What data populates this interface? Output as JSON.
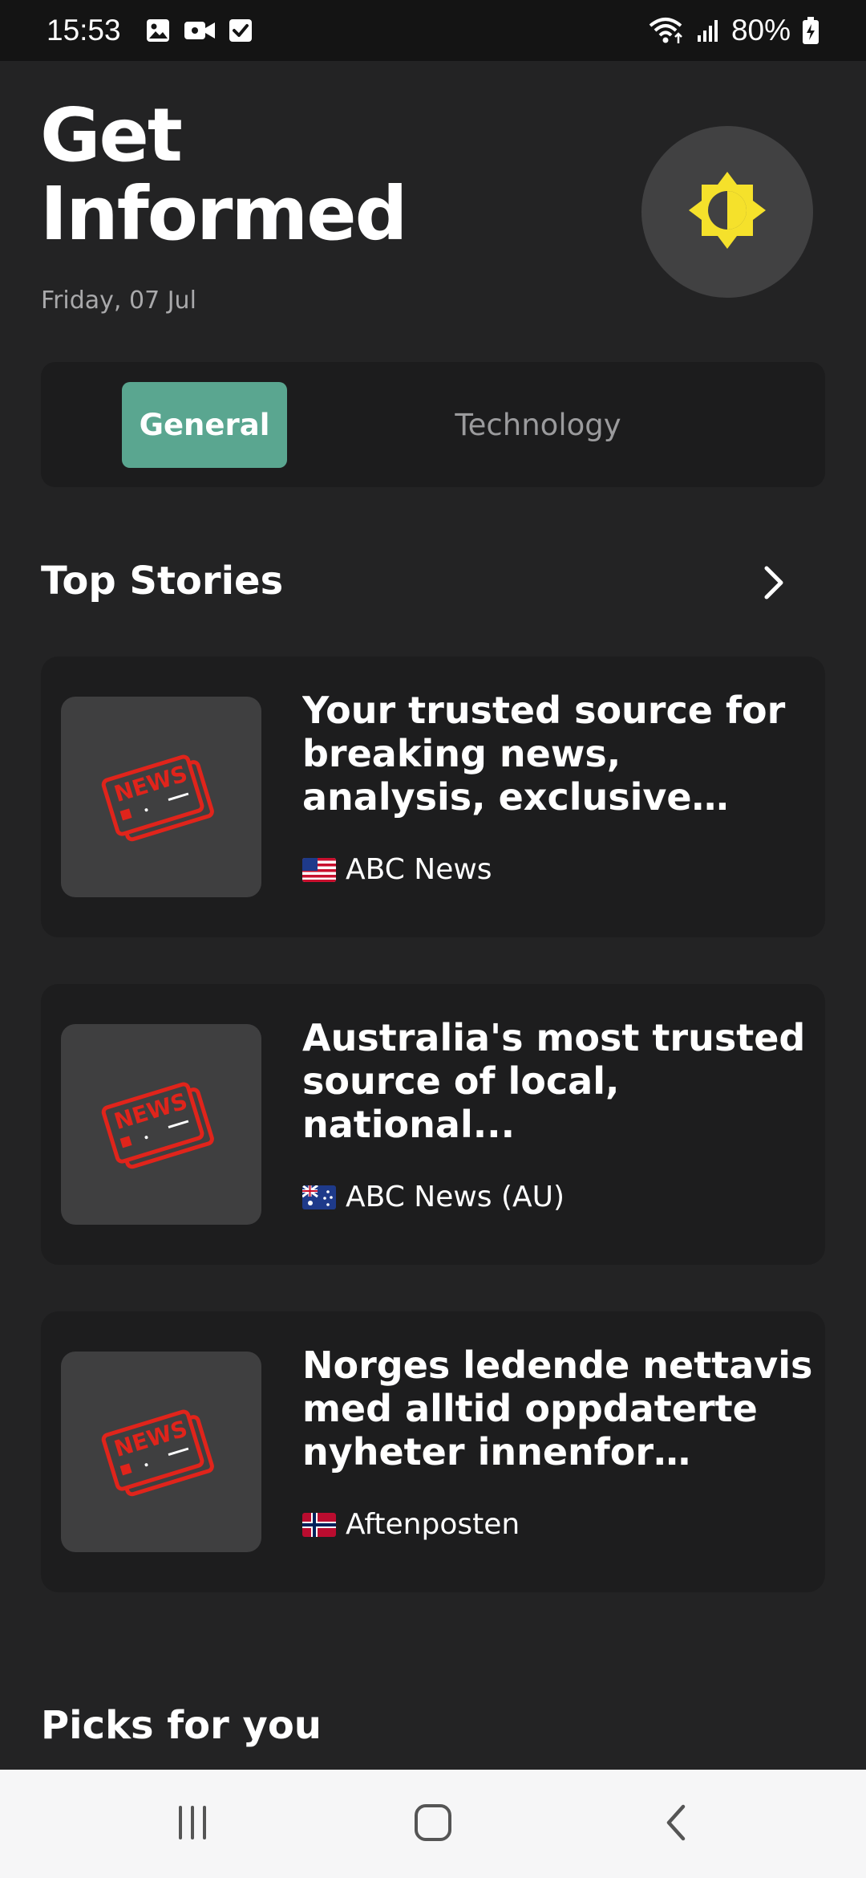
{
  "status_bar": {
    "time": "15:53",
    "battery": "80%",
    "icons": [
      "image-icon",
      "video-icon",
      "checkbox-icon",
      "wifi-icon",
      "signal-icon",
      "battery-icon"
    ]
  },
  "header": {
    "title": "Get Informed",
    "date": "Friday, 07 Jul",
    "theme_icon": "brightness-icon",
    "accent_color": "#f5e12b"
  },
  "tabs": [
    {
      "label": "General",
      "selected": true
    },
    {
      "label": "Technology",
      "selected": false
    }
  ],
  "accent_color": "#5aa690",
  "top_stories": {
    "title": "Top Stories",
    "arrow_icon": "chevron-right-icon",
    "items": [
      {
        "headline": "Your trusted source for breaking news, analysis, exclusive interviews, h...",
        "source": "ABC News",
        "flag": "us-flag-icon",
        "thumbnail": "news-placeholder-icon"
      },
      {
        "headline": "Australia's most trusted source of local, national...",
        "source": "ABC News (AU)",
        "flag": "au-flag-icon",
        "thumbnail": "news-placeholder-icon"
      },
      {
        "headline": "Norges ledende nettavis med alltid oppdaterte nyheter innenfor innenr...",
        "source": "Aftenposten",
        "flag": "no-flag-icon",
        "thumbnail": "news-placeholder-icon"
      }
    ]
  },
  "picks": {
    "title": "Picks for you"
  },
  "nav_bar": {
    "buttons": [
      "recents-icon",
      "home-icon",
      "back-icon"
    ]
  }
}
